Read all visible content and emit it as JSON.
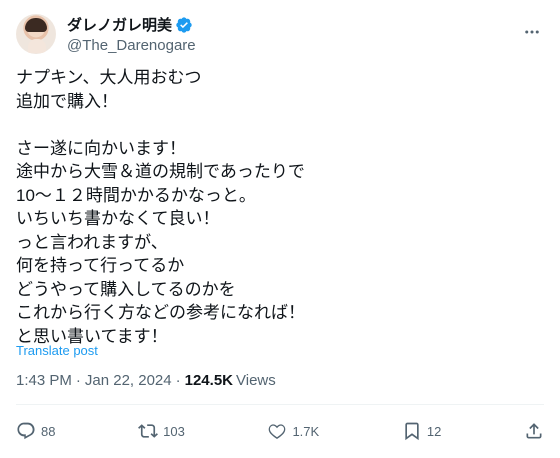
{
  "author": {
    "display_name": "ダレノガレ明美",
    "handle": "@The_Darenogare",
    "verified": true
  },
  "tweet": {
    "text": "ナプキン、大人用おむつ\n追加で購入！\n\nさー遂に向かいます！\n途中から大雪＆道の規制であったりで\n10〜１２時間かかるかなっと。\nいちいち書かなくて良い！\nっと言われますが、\n何を持って行ってるか\nどうやって購入してるのかを\nこれから行く方などの参考になれば！\nと思い書いてます！",
    "translate_label": "Translate post"
  },
  "meta": {
    "time": "1:43 PM",
    "separator": "·",
    "date": "Jan 22, 2024",
    "views_count": "124.5K",
    "views_label": "Views"
  },
  "actions": {
    "replies": "88",
    "reposts": "103",
    "likes": "1.7K",
    "bookmarks": "12"
  },
  "colors": {
    "accent": "#1d9bf0",
    "muted": "#536471",
    "text": "#0f1419"
  }
}
